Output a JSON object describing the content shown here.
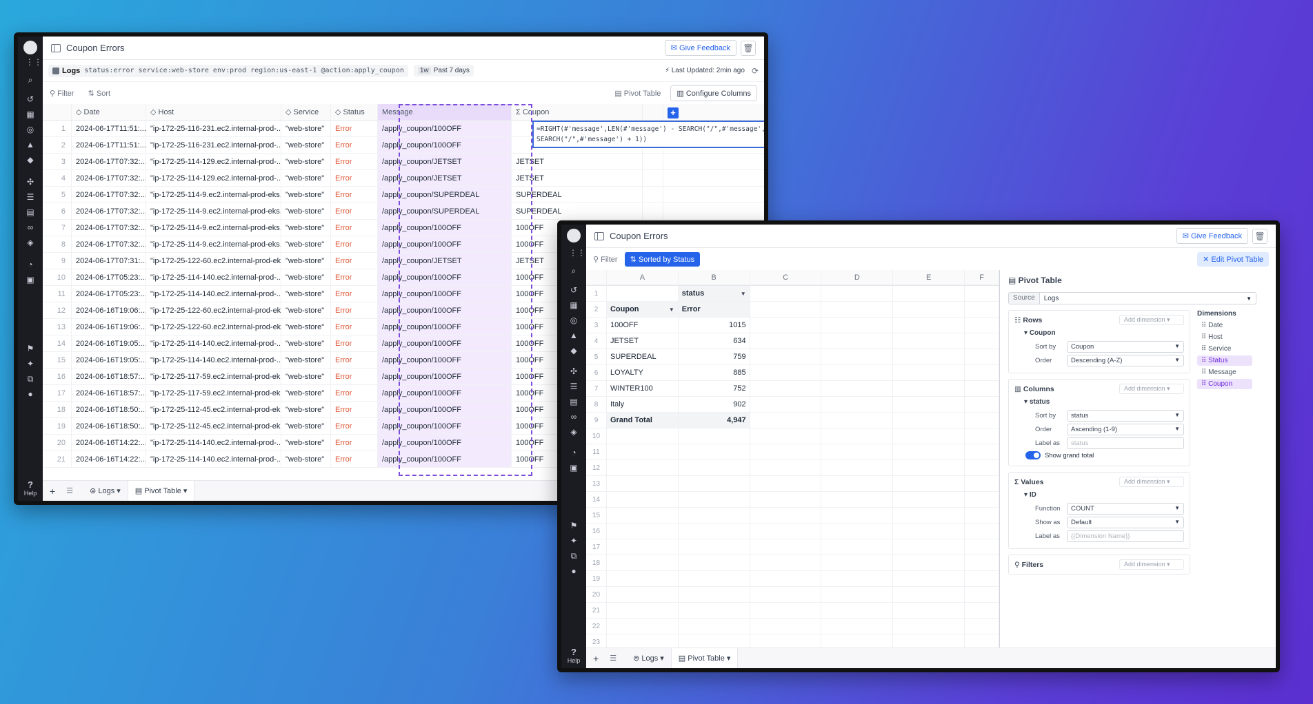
{
  "win1": {
    "title": "Coupon Errors",
    "give_feedback": "Give Feedback",
    "query_source": "Logs",
    "query": "status:error service:web-store env:prod region:us-east-1 @action:apply_coupon",
    "time_chip_short": "1w",
    "time_chip": "Past 7 days",
    "last_updated": "Last Updated: 2min ago",
    "filter": "Filter",
    "sort": "Sort",
    "pivot_table": "Pivot Table",
    "configure_columns": "Configure Columns",
    "columns": [
      "Date",
      "Host",
      "Service",
      "Status",
      "Message",
      "Coupon"
    ],
    "formula_line1": "=RIGHT(#'message',LEN(#'message') - SEARCH(\"/\",#'message',",
    "formula_line2": "SEARCH(\"/\",#'message') + 1))",
    "rows": [
      {
        "n": "1",
        "date": "2024-06-17T11:51:...",
        "host": "\"ip-172-25-116-231.ec2.internal-prod-...",
        "svc": "\"web-store\"",
        "st": "Error",
        "msg": "/apply_coupon/100OFF",
        "cp": ""
      },
      {
        "n": "2",
        "date": "2024-06-17T11:51:...",
        "host": "\"ip-172-25-116-231.ec2.internal-prod-...",
        "svc": "\"web-store\"",
        "st": "Error",
        "msg": "/apply_coupon/100OFF",
        "cp": ""
      },
      {
        "n": "3",
        "date": "2024-06-17T07:32:...",
        "host": "\"ip-172-25-114-129.ec2.internal-prod-...",
        "svc": "\"web-store\"",
        "st": "Error",
        "msg": "/apply_coupon/JETSET",
        "cp": "JETSET"
      },
      {
        "n": "4",
        "date": "2024-06-17T07:32:...",
        "host": "\"ip-172-25-114-129.ec2.internal-prod-...",
        "svc": "\"web-store\"",
        "st": "Error",
        "msg": "/apply_coupon/JETSET",
        "cp": "JETSET"
      },
      {
        "n": "5",
        "date": "2024-06-17T07:32:...",
        "host": "\"ip-172-25-114-9.ec2.internal-prod-eks...",
        "svc": "\"web-store\"",
        "st": "Error",
        "msg": "/apply_coupon/SUPERDEAL",
        "cp": "SUPERDEAL"
      },
      {
        "n": "6",
        "date": "2024-06-17T07:32:...",
        "host": "\"ip-172-25-114-9.ec2.internal-prod-eks...",
        "svc": "\"web-store\"",
        "st": "Error",
        "msg": "/apply_coupon/SUPERDEAL",
        "cp": "SUPERDEAL"
      },
      {
        "n": "7",
        "date": "2024-06-17T07:32:...",
        "host": "\"ip-172-25-114-9.ec2.internal-prod-eks...",
        "svc": "\"web-store\"",
        "st": "Error",
        "msg": "/apply_coupon/100OFF",
        "cp": "100OFF"
      },
      {
        "n": "8",
        "date": "2024-06-17T07:32:...",
        "host": "\"ip-172-25-114-9.ec2.internal-prod-eks...",
        "svc": "\"web-store\"",
        "st": "Error",
        "msg": "/apply_coupon/100OFF",
        "cp": "100OFF"
      },
      {
        "n": "9",
        "date": "2024-06-17T07:31:...",
        "host": "\"ip-172-25-122-60.ec2.internal-prod-ek...",
        "svc": "\"web-store\"",
        "st": "Error",
        "msg": "/apply_coupon/JETSET",
        "cp": "JETSET"
      },
      {
        "n": "10",
        "date": "2024-06-17T05:23:...",
        "host": "\"ip-172-25-114-140.ec2.internal-prod-...",
        "svc": "\"web-store\"",
        "st": "Error",
        "msg": "/apply_coupon/100OFF",
        "cp": "100OFF"
      },
      {
        "n": "11",
        "date": "2024-06-17T05:23:...",
        "host": "\"ip-172-25-114-140.ec2.internal-prod-...",
        "svc": "\"web-store\"",
        "st": "Error",
        "msg": "/apply_coupon/100OFF",
        "cp": "100OFF"
      },
      {
        "n": "12",
        "date": "2024-06-16T19:06:...",
        "host": "\"ip-172-25-122-60.ec2.internal-prod-ek...",
        "svc": "\"web-store\"",
        "st": "Error",
        "msg": "/apply_coupon/100OFF",
        "cp": "100OFF"
      },
      {
        "n": "13",
        "date": "2024-06-16T19:06:...",
        "host": "\"ip-172-25-122-60.ec2.internal-prod-ek...",
        "svc": "\"web-store\"",
        "st": "Error",
        "msg": "/apply_coupon/100OFF",
        "cp": "100OFF"
      },
      {
        "n": "14",
        "date": "2024-06-16T19:05:...",
        "host": "\"ip-172-25-114-140.ec2.internal-prod-...",
        "svc": "\"web-store\"",
        "st": "Error",
        "msg": "/apply_coupon/100OFF",
        "cp": "100OFF"
      },
      {
        "n": "15",
        "date": "2024-06-16T19:05:...",
        "host": "\"ip-172-25-114-140.ec2.internal-prod-...",
        "svc": "\"web-store\"",
        "st": "Error",
        "msg": "/apply_coupon/100OFF",
        "cp": "100OFF"
      },
      {
        "n": "16",
        "date": "2024-06-16T18:57:...",
        "host": "\"ip-172-25-117-59.ec2.internal-prod-ek...",
        "svc": "\"web-store\"",
        "st": "Error",
        "msg": "/apply_coupon/100OFF",
        "cp": "100OFF"
      },
      {
        "n": "17",
        "date": "2024-06-16T18:57:...",
        "host": "\"ip-172-25-117-59.ec2.internal-prod-ek...",
        "svc": "\"web-store\"",
        "st": "Error",
        "msg": "/apply_coupon/100OFF",
        "cp": "100OFF"
      },
      {
        "n": "18",
        "date": "2024-06-16T18:50:...",
        "host": "\"ip-172-25-112-45.ec2.internal-prod-ek...",
        "svc": "\"web-store\"",
        "st": "Error",
        "msg": "/apply_coupon/100OFF",
        "cp": "100OFF"
      },
      {
        "n": "19",
        "date": "2024-06-16T18:50:...",
        "host": "\"ip-172-25-112-45.ec2.internal-prod-ek...",
        "svc": "\"web-store\"",
        "st": "Error",
        "msg": "/apply_coupon/100OFF",
        "cp": "100OFF"
      },
      {
        "n": "20",
        "date": "2024-06-16T14:22:...",
        "host": "\"ip-172-25-114-140.ec2.internal-prod-...",
        "svc": "\"web-store\"",
        "st": "Error",
        "msg": "/apply_coupon/100OFF",
        "cp": "100OFF"
      },
      {
        "n": "21",
        "date": "2024-06-16T14:22:...",
        "host": "\"ip-172-25-114-140.ec2.internal-prod-...",
        "svc": "\"web-store\"",
        "st": "Error",
        "msg": "/apply_coupon/100OFF",
        "cp": "100OFF"
      }
    ],
    "tabs": [
      "Logs",
      "Pivot Table"
    ]
  },
  "win2": {
    "title": "Coupon Errors",
    "give_feedback": "Give Feedback",
    "filter": "Filter",
    "sorted_by": "Sorted by Status",
    "edit_pivot": "Edit Pivot Table",
    "col_letters": [
      "A",
      "B",
      "C",
      "D",
      "E",
      "F"
    ],
    "pivot_header_status": "status",
    "pivot_header_coupon": "Coupon",
    "pivot_header_error": "Error",
    "pivot_rows": [
      {
        "label": "100OFF",
        "value": "1015"
      },
      {
        "label": "JETSET",
        "value": "634"
      },
      {
        "label": "SUPERDEAL",
        "value": "759"
      },
      {
        "label": "LOYALTY",
        "value": "885"
      },
      {
        "label": "WINTER100",
        "value": "752"
      },
      {
        "label": "Italy",
        "value": "902"
      }
    ],
    "grand_total_label": "Grand Total",
    "grand_total_value": "4,947",
    "row_numbers": [
      "1",
      "2",
      "3",
      "4",
      "5",
      "6",
      "7",
      "8",
      "9",
      "10",
      "11",
      "12",
      "13",
      "14",
      "15",
      "16",
      "17",
      "18",
      "19",
      "20",
      "21",
      "22",
      "23"
    ],
    "tabs": [
      "Logs",
      "Pivot Table"
    ],
    "panel": {
      "title": "Pivot Table",
      "source_label": "Source",
      "source_value": "Logs",
      "add_dimension": "Add dimension",
      "rows_label": "Rows",
      "rows_field": "Coupon",
      "rows_sort_by_k": "Sort by",
      "rows_sort_by_v": "Coupon",
      "rows_order_k": "Order",
      "rows_order_v": "Descending (A-Z)",
      "columns_label": "Columns",
      "columns_field": "status",
      "columns_sort_by_v": "status",
      "columns_order_v": "Ascending (1-9)",
      "label_as_k": "Label as",
      "columns_label_as_ph": "status",
      "show_grand_total": "Show grand total",
      "values_label": "Values",
      "values_field": "ID",
      "function_k": "Function",
      "function_v": "COUNT",
      "show_as_k": "Show as",
      "show_as_v": "Default",
      "values_label_as_ph": "{{Dimension Name}}",
      "filters_label": "Filters",
      "dimensions_label": "Dimensions",
      "dimensions": [
        "Date",
        "Host",
        "Service",
        "Status",
        "Message",
        "Coupon"
      ]
    }
  },
  "help_label": "Help"
}
